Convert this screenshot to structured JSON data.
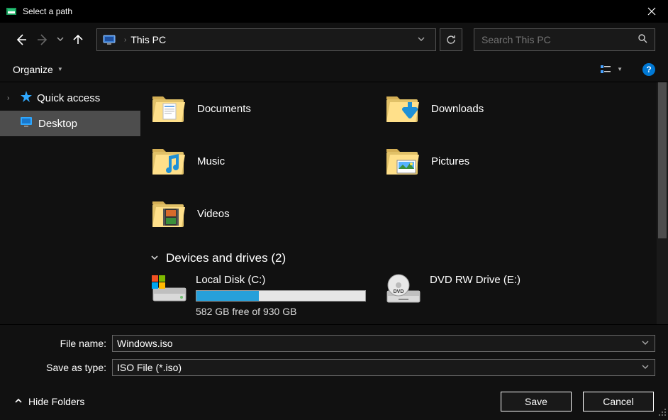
{
  "window": {
    "title": "Select a path"
  },
  "address": {
    "crumb": "This PC"
  },
  "search": {
    "placeholder": "Search This PC"
  },
  "toolbar": {
    "organize": "Organize",
    "help": "?"
  },
  "sidebar": {
    "quick_access": "Quick access",
    "desktop": "Desktop"
  },
  "folders": [
    {
      "label": "Documents"
    },
    {
      "label": "Downloads"
    },
    {
      "label": "Music"
    },
    {
      "label": "Pictures"
    },
    {
      "label": "Videos"
    }
  ],
  "group": {
    "label": "Devices and drives (2)"
  },
  "drives": {
    "local": {
      "name": "Local Disk (C:)",
      "free": "582 GB free of 930 GB",
      "used_pct": 37
    },
    "dvd": {
      "name": "DVD RW Drive (E:)"
    }
  },
  "filename": {
    "label": "File name:",
    "value": "Windows.iso"
  },
  "savetype": {
    "label": "Save as type:",
    "value": "ISO File (*.iso)"
  },
  "hide_folders": "Hide Folders",
  "buttons": {
    "save": "Save",
    "cancel": "Cancel"
  }
}
